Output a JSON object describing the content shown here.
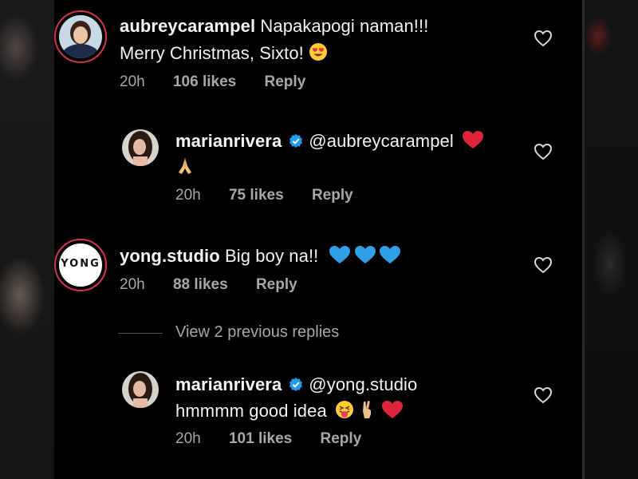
{
  "comments": [
    {
      "username": "aubreycarampel",
      "text_line1": "Napakapogi naman!!!",
      "text_line2": "Merry Christmas, Sixto!",
      "emoji": "heart-eyes-emoji",
      "time": "20h",
      "likes": "106 likes",
      "reply": "Reply"
    },
    {
      "username": "marianrivera",
      "mention": "@aubreycarampel",
      "emoji": "red-heart-emoji",
      "emoji2": "folded-hands-emoji",
      "time": "20h",
      "likes": "75 likes",
      "reply": "Reply"
    },
    {
      "username": "yong.studio",
      "avatar_text": "YONG",
      "text": "Big boy na!!",
      "emoji": "blue-hearts-emoji",
      "time": "20h",
      "likes": "88 likes",
      "reply": "Reply"
    },
    {
      "username": "marianrivera",
      "mention": "@yong.studio",
      "text_line2": "hmmmm good idea",
      "emoji": "tongue-crossed-fingers-heart-emoji",
      "time": "20h",
      "likes": "101 likes",
      "reply": "Reply"
    }
  ],
  "view_replies": "View 2 previous replies",
  "colors": {
    "background": "#000000",
    "text": "#f2f2f2",
    "meta": "#a8a8a8",
    "verified_blue": "#1d9bf0",
    "heart_red": "#e0243a",
    "blue_heart": "#2f9fe8"
  }
}
